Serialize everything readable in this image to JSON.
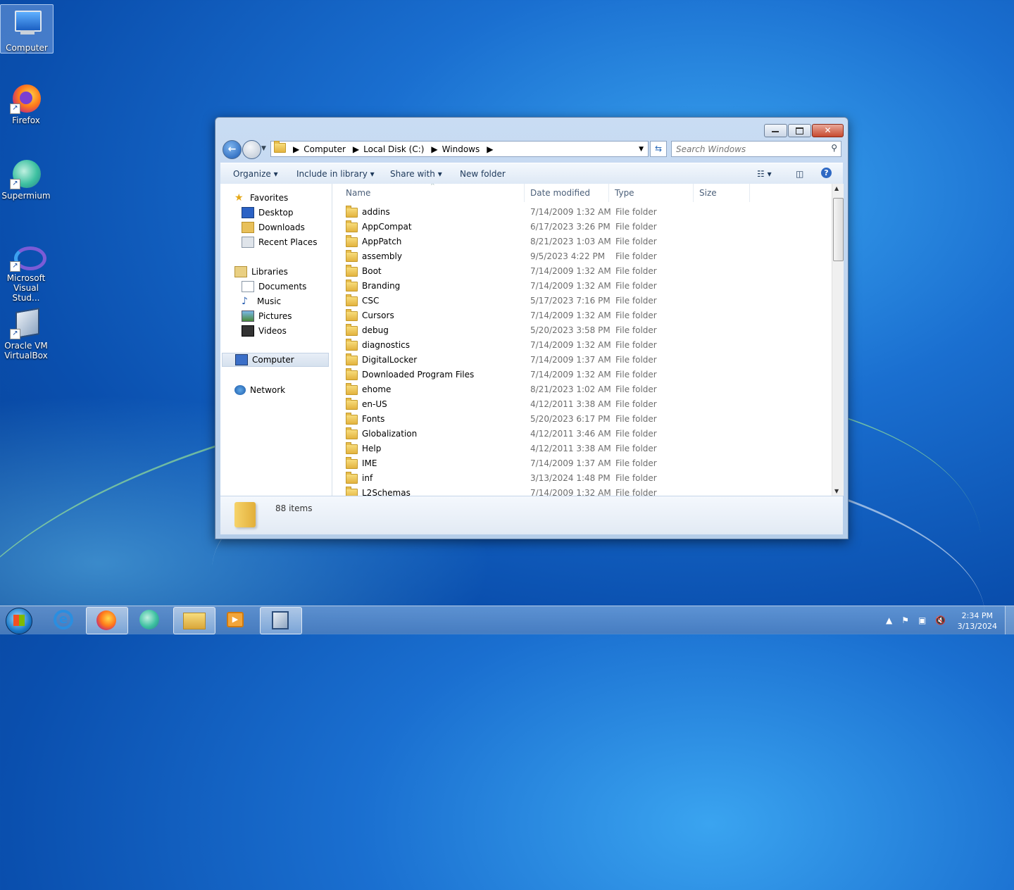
{
  "desktop": {
    "icons": [
      {
        "label": "Computer"
      },
      {
        "label": "Firefox"
      },
      {
        "label": "Supermium"
      },
      {
        "label": "Microsoft Visual Stud..."
      },
      {
        "label": "Oracle VM VirtualBox"
      }
    ]
  },
  "explorer": {
    "address": [
      "Computer",
      "Local Disk (C:)",
      "Windows"
    ],
    "search_placeholder": "Search Windows",
    "toolbar": {
      "organize": "Organize",
      "include": "Include in library",
      "share": "Share with",
      "new_folder": "New folder"
    },
    "nav": {
      "favorites": "Favorites",
      "desktop": "Desktop",
      "downloads": "Downloads",
      "recent": "Recent Places",
      "libraries": "Libraries",
      "documents": "Documents",
      "music": "Music",
      "pictures": "Pictures",
      "videos": "Videos",
      "computer": "Computer",
      "network": "Network"
    },
    "columns": {
      "name": "Name",
      "date": "Date modified",
      "type": "Type",
      "size": "Size"
    },
    "files": [
      {
        "name": "addins",
        "date": "7/14/2009 1:32 AM",
        "type": "File folder"
      },
      {
        "name": "AppCompat",
        "date": "6/17/2023 3:26 PM",
        "type": "File folder"
      },
      {
        "name": "AppPatch",
        "date": "8/21/2023 1:03 AM",
        "type": "File folder"
      },
      {
        "name": "assembly",
        "date": "9/5/2023 4:22 PM",
        "type": "File folder"
      },
      {
        "name": "Boot",
        "date": "7/14/2009 1:32 AM",
        "type": "File folder"
      },
      {
        "name": "Branding",
        "date": "7/14/2009 1:32 AM",
        "type": "File folder"
      },
      {
        "name": "CSC",
        "date": "5/17/2023 7:16 PM",
        "type": "File folder"
      },
      {
        "name": "Cursors",
        "date": "7/14/2009 1:32 AM",
        "type": "File folder"
      },
      {
        "name": "debug",
        "date": "5/20/2023 3:58 PM",
        "type": "File folder"
      },
      {
        "name": "diagnostics",
        "date": "7/14/2009 1:32 AM",
        "type": "File folder"
      },
      {
        "name": "DigitalLocker",
        "date": "7/14/2009 1:37 AM",
        "type": "File folder"
      },
      {
        "name": "Downloaded Program Files",
        "date": "7/14/2009 1:32 AM",
        "type": "File folder"
      },
      {
        "name": "ehome",
        "date": "8/21/2023 1:02 AM",
        "type": "File folder"
      },
      {
        "name": "en-US",
        "date": "4/12/2011 3:38 AM",
        "type": "File folder"
      },
      {
        "name": "Fonts",
        "date": "5/20/2023 6:17 PM",
        "type": "File folder"
      },
      {
        "name": "Globalization",
        "date": "4/12/2011 3:46 AM",
        "type": "File folder"
      },
      {
        "name": "Help",
        "date": "4/12/2011 3:38 AM",
        "type": "File folder"
      },
      {
        "name": "IME",
        "date": "7/14/2009 1:37 AM",
        "type": "File folder"
      },
      {
        "name": "inf",
        "date": "3/13/2024 1:48 PM",
        "type": "File folder"
      },
      {
        "name": "L2Schemas",
        "date": "7/14/2009 1:32 AM",
        "type": "File folder"
      }
    ],
    "status": "88 items"
  },
  "taskbar": {
    "time": "2:34 PM",
    "date": "3/13/2024"
  }
}
